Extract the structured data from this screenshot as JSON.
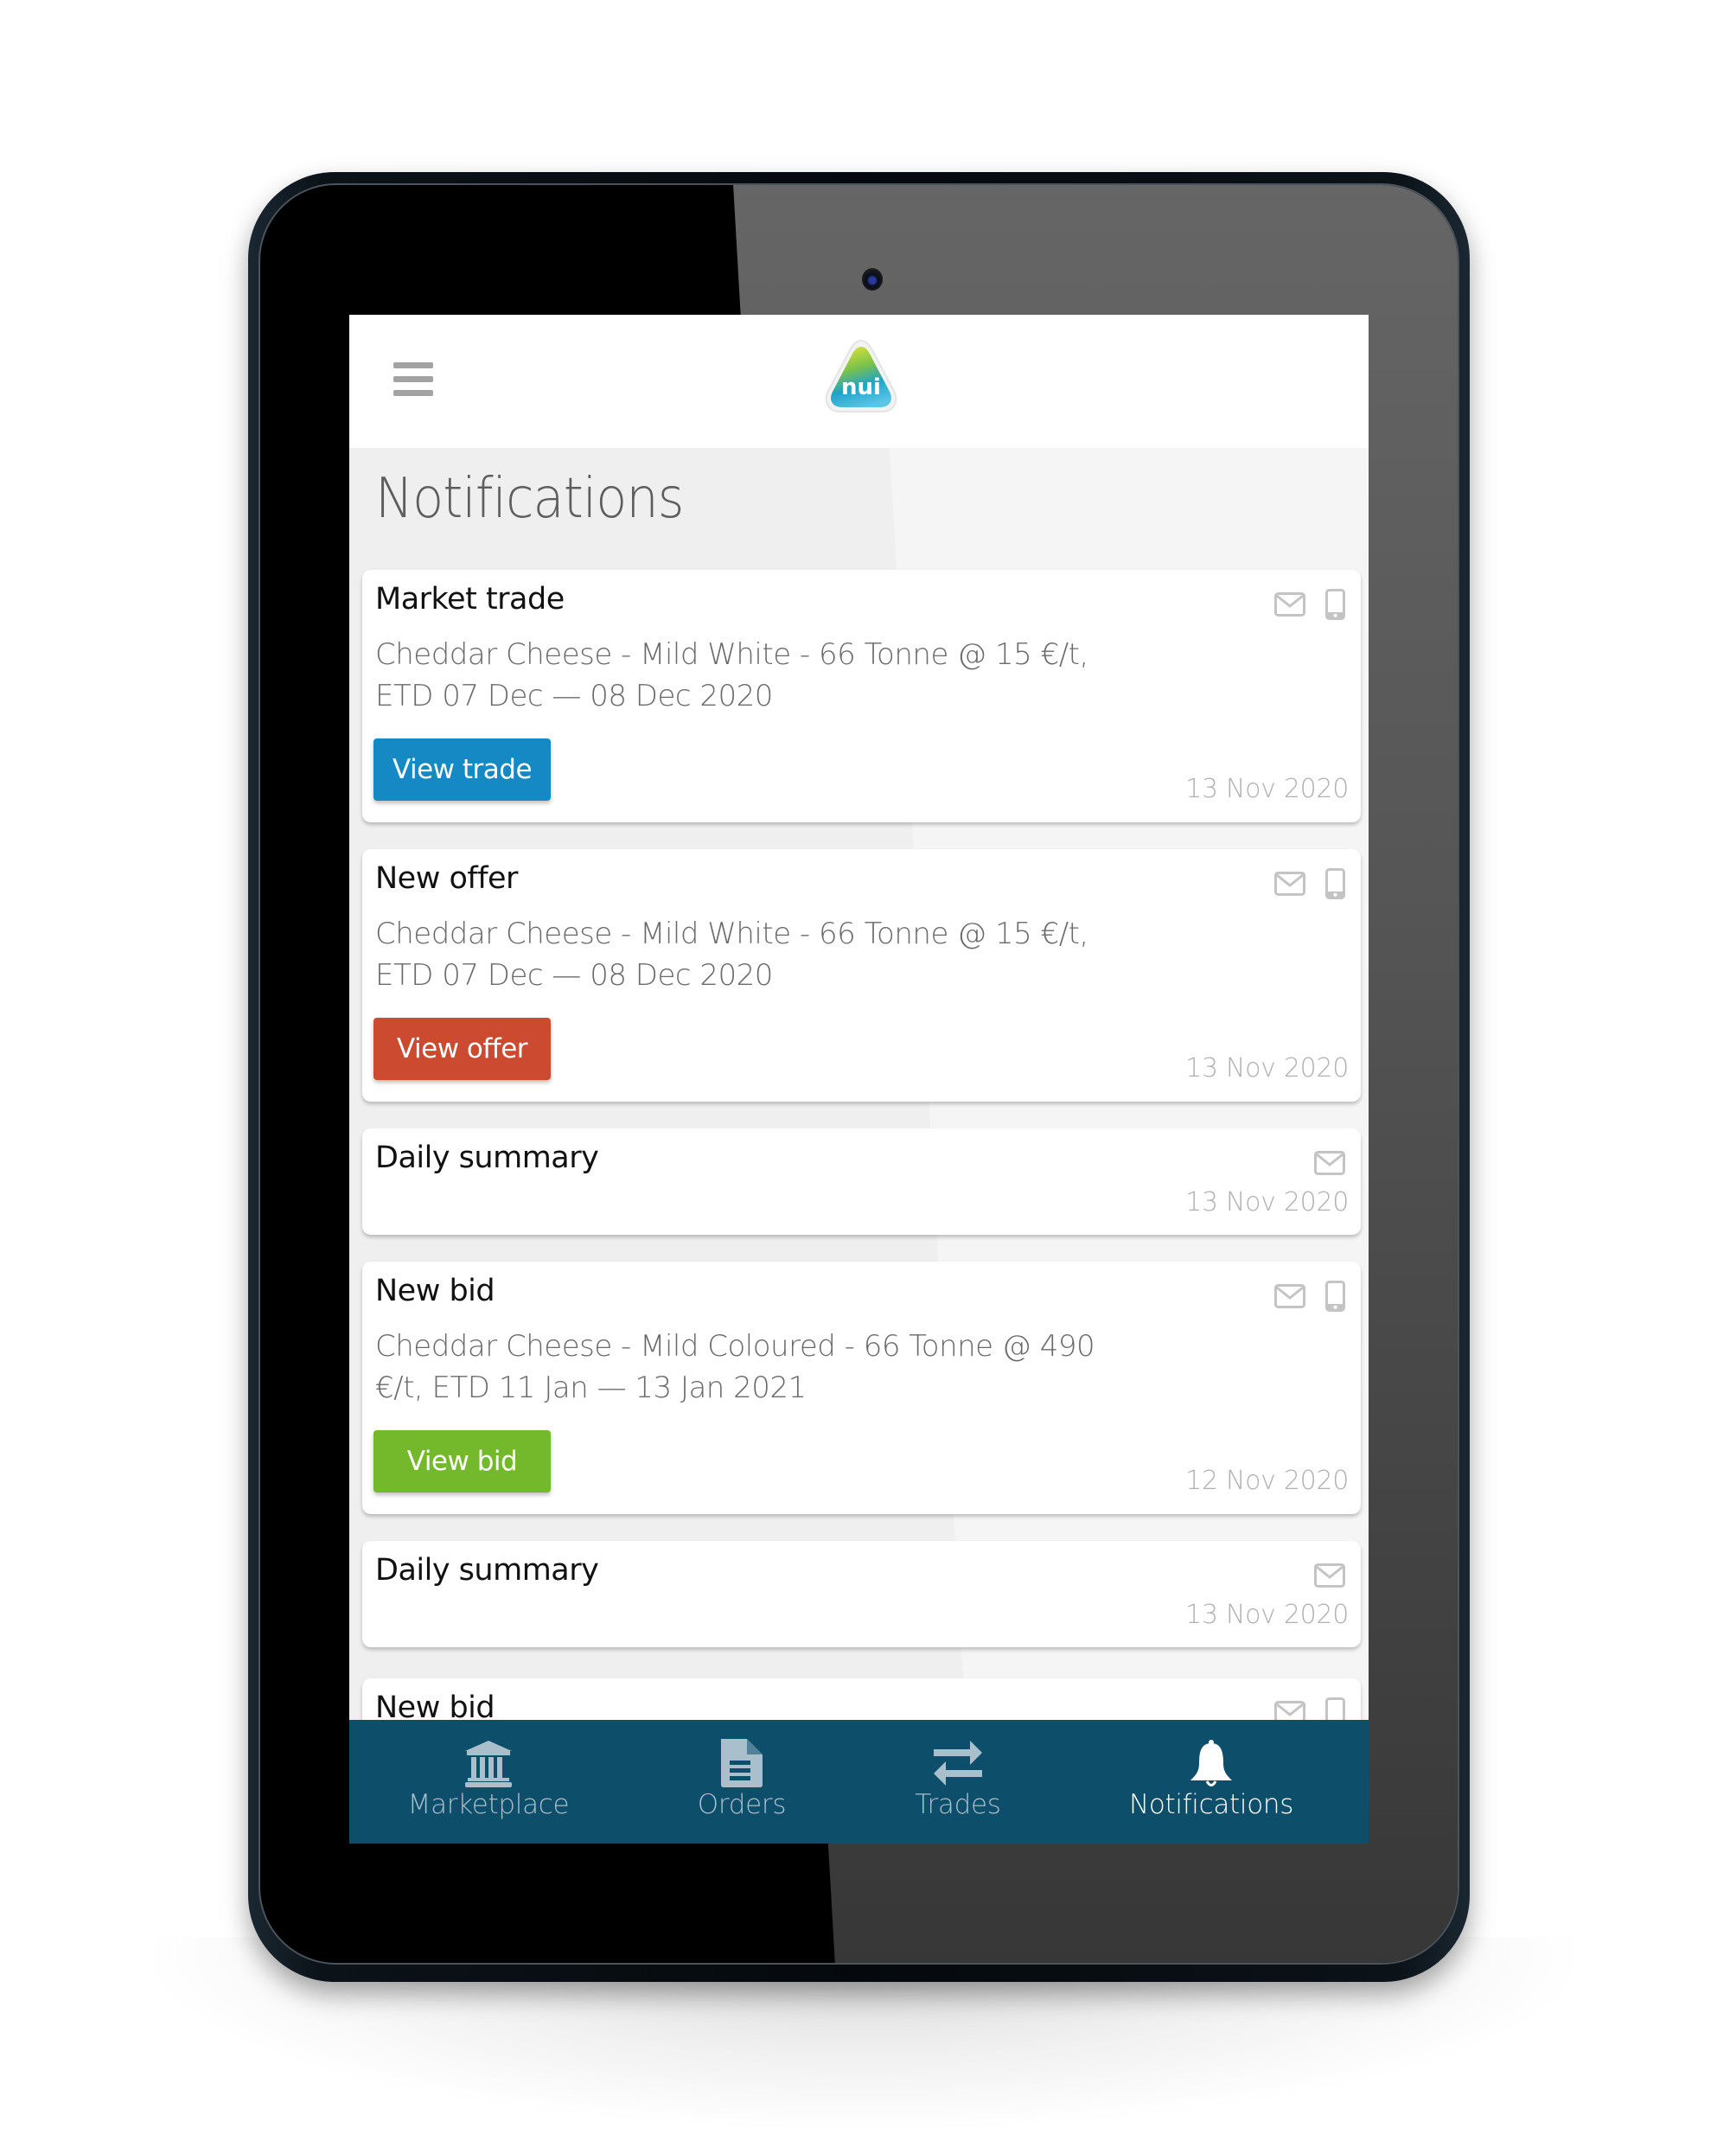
{
  "app": {
    "brand": "nui",
    "page_title": "Notifications"
  },
  "colors": {
    "trade_button": "#1589c3",
    "offer_button": "#cc4b30",
    "bid_button": "#73b92b",
    "nav_background": "#0d4f6b",
    "nav_inactive": "#a9bfcc",
    "nav_active": "#ffffff"
  },
  "notifications": [
    {
      "title": "Market trade",
      "body_line1": "Cheddar Cheese - Mild White - 66 Tonne @ 15 €/t,",
      "body_line2": "ETD 07 Dec — 08 Dec 2020",
      "button_label": "View trade",
      "button_kind": "trade",
      "date": "13 Nov 2020",
      "channels": [
        "email-icon",
        "phone-icon"
      ]
    },
    {
      "title": "New offer",
      "body_line1": "Cheddar Cheese - Mild White - 66 Tonne @ 15 €/t,",
      "body_line2": "ETD 07 Dec — 08 Dec 2020",
      "button_label": "View offer",
      "button_kind": "offer",
      "date": "13 Nov 2020",
      "channels": [
        "email-icon",
        "phone-icon"
      ]
    },
    {
      "title": "Daily summary",
      "date": "13 Nov 2020",
      "channels": [
        "email-icon"
      ]
    },
    {
      "title": "New bid",
      "body_line1": "Cheddar Cheese - Mild Coloured - 66 Tonne @ 490",
      "body_line2": "€/t, ETD 11 Jan — 13 Jan 2021",
      "button_label": "View bid",
      "button_kind": "bid",
      "date": "12 Nov 2020",
      "channels": [
        "email-icon",
        "phone-icon"
      ]
    },
    {
      "title": "Daily summary",
      "date": "13 Nov 2020",
      "channels": [
        "email-icon"
      ]
    },
    {
      "title": "New bid",
      "channels": [
        "email-icon",
        "phone-icon"
      ]
    }
  ],
  "bottom_nav": [
    {
      "label": "Marketplace",
      "icon": "bank-icon",
      "active": false
    },
    {
      "label": "Orders",
      "icon": "document-icon",
      "active": false
    },
    {
      "label": "Trades",
      "icon": "swap-arrows-icon",
      "active": false
    },
    {
      "label": "Notifications",
      "icon": "bell-icon",
      "active": true
    }
  ]
}
